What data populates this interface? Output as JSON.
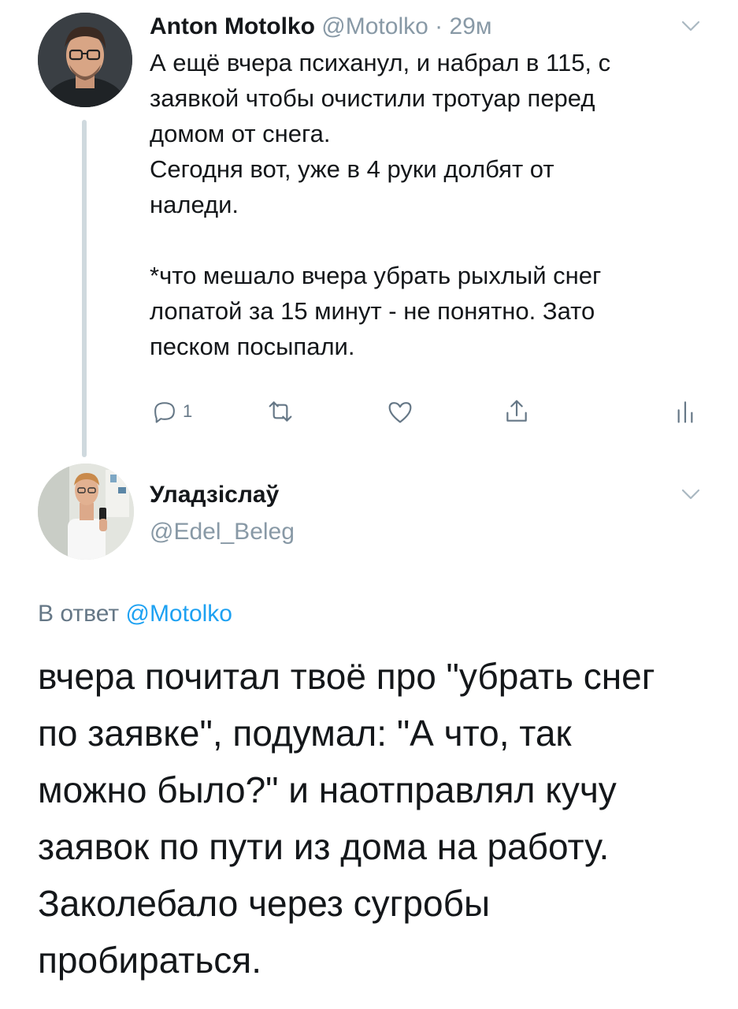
{
  "tweet1": {
    "author_name": "Anton Motolko",
    "meta": "@Motolko · 29м",
    "lines": [
      "А ещё вчера психанул, и набрал в 115, с",
      "заявкой чтобы очистили тротуар перед",
      "домом от снега.",
      "Сегодня вот, уже в 4 руки долбят от",
      "наледи."
    ],
    "note_lines": [
      "*что мешало вчера убрать рыхлый снег",
      "лопатой за 15 минут - не понятно. Зато",
      "песком посыпали."
    ],
    "reply_count": "1",
    "icons": [
      "reply-icon",
      "retweet-icon",
      "like-icon",
      "share-icon",
      "analytics-icon",
      "chevron-down-icon"
    ]
  },
  "tweet2": {
    "author_name": "Уладзіслаў",
    "handle": "@Edel_Beleg",
    "reply_to_prefix": "В ответ ",
    "reply_to_mention": "@Motolko",
    "lines": [
      "вчера почитал твоё про \"убрать снег",
      "по заявке\", подумал: \"А что, так",
      "можно было?\" и наотправлял кучу",
      "заявок по пути из дома на работу.",
      "Заколебало через сугробы",
      "пробираться."
    ]
  },
  "colors": {
    "text": "#14171a",
    "secondary": "#8899a6",
    "link": "#1da1f2",
    "thread_line": "#cfd9de",
    "icon": "#657786"
  }
}
